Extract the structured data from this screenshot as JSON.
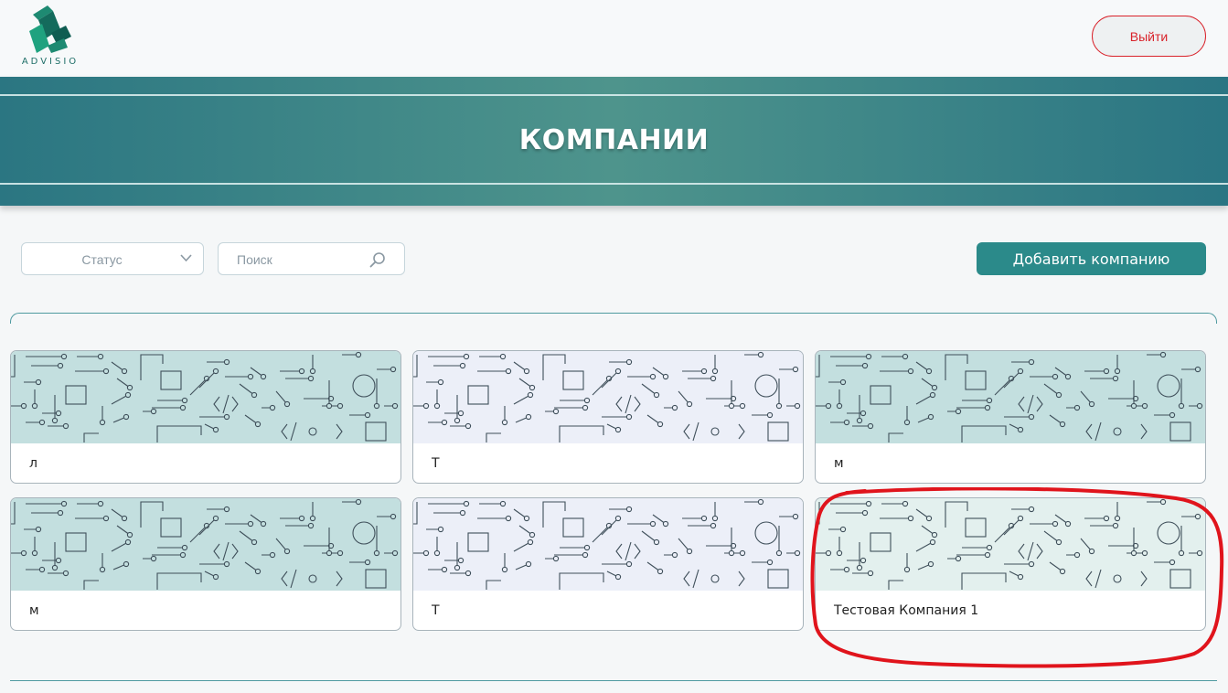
{
  "header": {
    "logo_text": "ADVISIO",
    "logout_label": "Выйти"
  },
  "banner": {
    "title": "КОМПАНИИ"
  },
  "filters": {
    "status_label": "Статус",
    "search_placeholder": "Поиск",
    "add_company_label": "Добавить компанию"
  },
  "colors": {
    "accent": "#2b8a8a",
    "logout": "#d9222a",
    "cover_teal": "#c3dfdf",
    "cover_lavender": "#eceff8",
    "cover_mint": "#e3f0ee",
    "highlight": "#e0141c"
  },
  "companies": [
    {
      "name": "л",
      "cover": "teal"
    },
    {
      "name": "Т",
      "cover": "lavender"
    },
    {
      "name": "м",
      "cover": "teal"
    },
    {
      "name": "м",
      "cover": "teal"
    },
    {
      "name": "Т",
      "cover": "lavender"
    },
    {
      "name": "Тестовая Компания 1",
      "cover": "mint",
      "highlighted": true
    }
  ],
  "icons": [
    "logo-icon",
    "chevron-down-icon",
    "search-icon"
  ]
}
